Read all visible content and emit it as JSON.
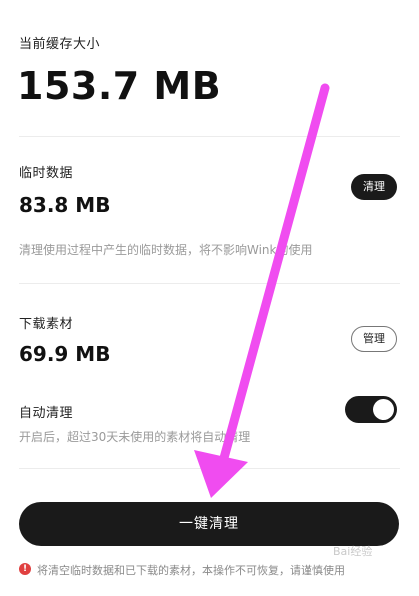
{
  "cache": {
    "title": "当前缓存大小",
    "total": "153.7 MB"
  },
  "temp": {
    "label": "临时数据",
    "size": "83.8 MB",
    "button": "清理",
    "desc": "清理使用过程中产生的临时数据，将不影响Wink的使用"
  },
  "downloads": {
    "label": "下载素材",
    "size": "69.9 MB",
    "button": "管理"
  },
  "auto_clean": {
    "label": "自动清理",
    "desc": "开启后，超过30天未使用的素材将自动清理",
    "enabled": true
  },
  "main_button": "一键清理",
  "warning": {
    "icon": "!",
    "text": "将清空临时数据和已下载的素材，本操作不可恢复，请谨慎使用"
  },
  "watermark": "Bai经验",
  "colors": {
    "accent": "#1a1a1a",
    "arrow": "#f04cf0",
    "warn": "#e04040"
  }
}
